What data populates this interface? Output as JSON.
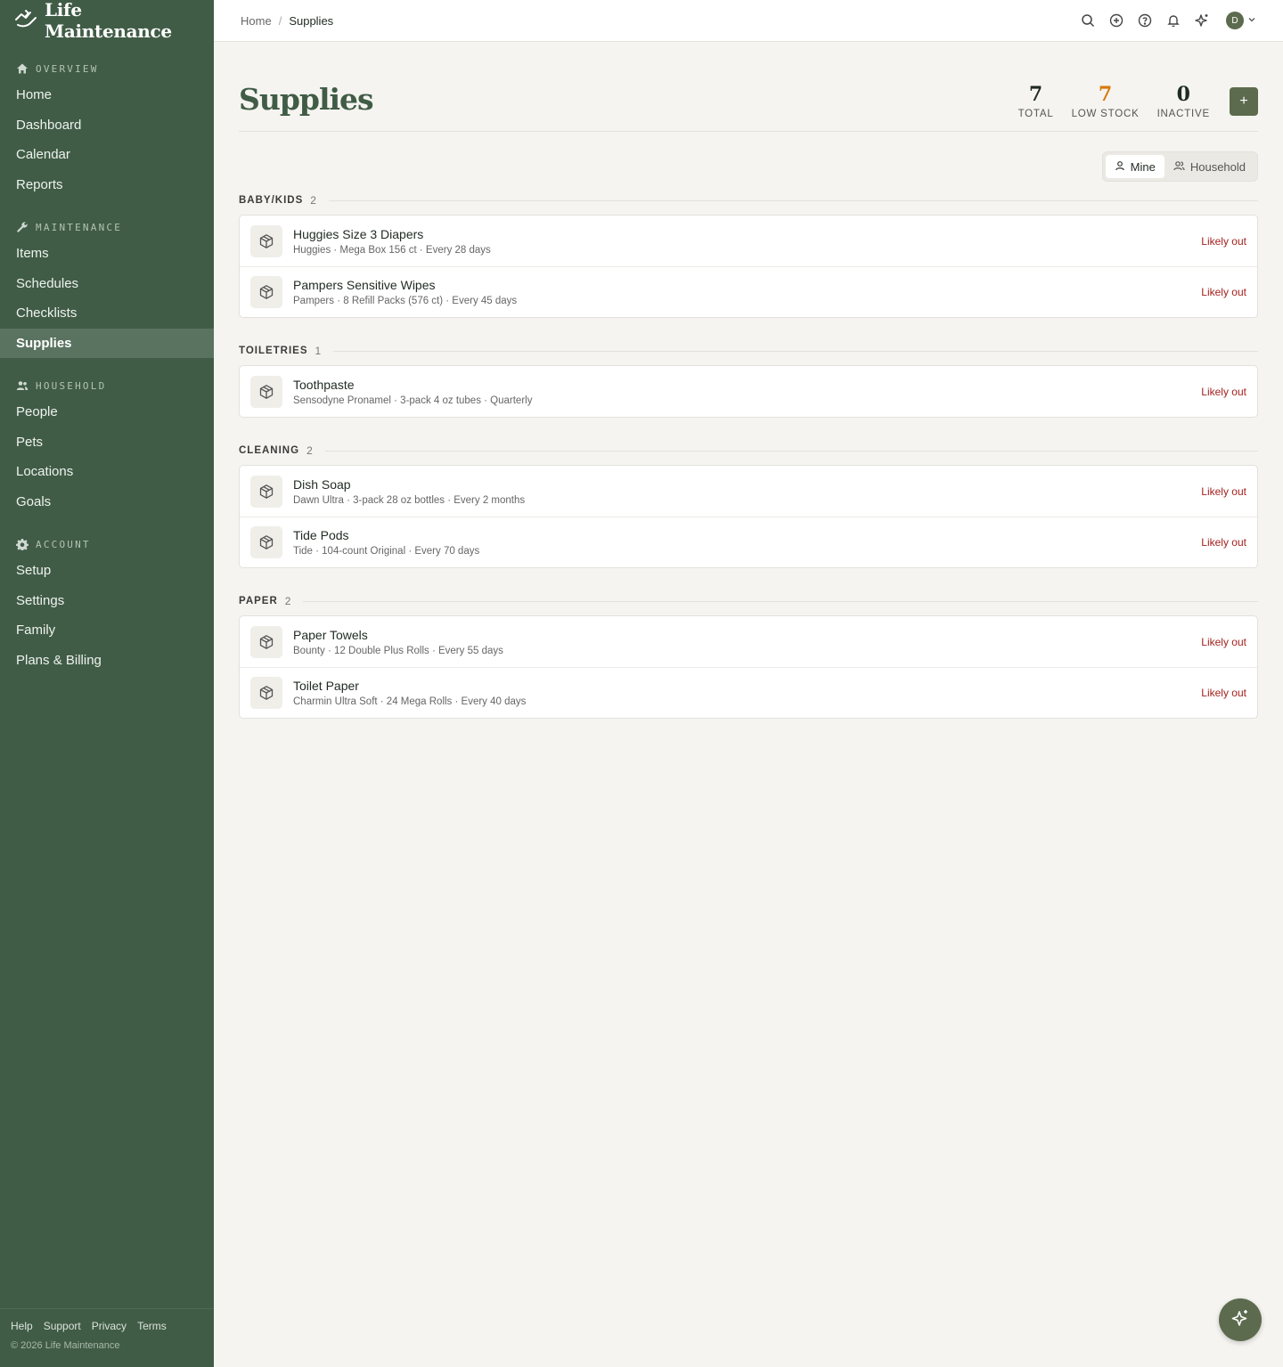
{
  "app": {
    "title": "Life Maintenance",
    "copyright": "© 2026 Life Maintenance"
  },
  "colors": {
    "sidebar": "#405c46",
    "accent": "#5c6b4e",
    "low_stock": "#d97706",
    "status_red": "#a3221f"
  },
  "sidebar": {
    "sections": [
      {
        "title": "OVERVIEW",
        "icon": "home-icon",
        "items": [
          {
            "label": "Home"
          },
          {
            "label": "Dashboard"
          },
          {
            "label": "Calendar"
          },
          {
            "label": "Reports"
          }
        ]
      },
      {
        "title": "MAINTENANCE",
        "icon": "wrench-icon",
        "items": [
          {
            "label": "Items"
          },
          {
            "label": "Schedules"
          },
          {
            "label": "Checklists"
          },
          {
            "label": "Supplies",
            "active": true
          }
        ]
      },
      {
        "title": "HOUSEHOLD",
        "icon": "users-icon",
        "items": [
          {
            "label": "People"
          },
          {
            "label": "Pets"
          },
          {
            "label": "Locations"
          },
          {
            "label": "Goals"
          }
        ]
      },
      {
        "title": "ACCOUNT",
        "icon": "gear-icon",
        "items": [
          {
            "label": "Setup"
          },
          {
            "label": "Settings"
          },
          {
            "label": "Family"
          },
          {
            "label": "Plans & Billing"
          }
        ]
      }
    ],
    "footer_links": [
      "Help",
      "Support",
      "Privacy",
      "Terms"
    ]
  },
  "topbar": {
    "breadcrumb": {
      "home": "Home",
      "separator": "/",
      "current": "Supplies"
    },
    "icons": [
      "search-icon",
      "plus-circle-icon",
      "help-icon",
      "bell-icon",
      "sparkle-icon"
    ],
    "avatar": "D"
  },
  "page": {
    "title": "Supplies",
    "stats": [
      {
        "value": "7",
        "label": "TOTAL",
        "color": "#1f2a22"
      },
      {
        "value": "7",
        "label": "LOW STOCK",
        "color": "#d97706"
      },
      {
        "value": "0",
        "label": "INACTIVE",
        "color": "#1f2a22"
      }
    ],
    "add_label": "+",
    "toggle": {
      "mine": "Mine",
      "household": "Household"
    }
  },
  "groups": [
    {
      "name": "BABY/KIDS",
      "count": "2",
      "items": [
        {
          "name": "Huggies Size 3 Diapers",
          "meta": "Huggies · Mega Box 156 ct · Every 28 days",
          "status": "Likely out"
        },
        {
          "name": "Pampers Sensitive Wipes",
          "meta": "Pampers · 8 Refill Packs (576 ct) · Every 45 days",
          "status": "Likely out"
        }
      ]
    },
    {
      "name": "TOILETRIES",
      "count": "1",
      "items": [
        {
          "name": "Toothpaste",
          "meta": "Sensodyne Pronamel · 3-pack 4 oz tubes · Quarterly",
          "status": "Likely out"
        }
      ]
    },
    {
      "name": "CLEANING",
      "count": "2",
      "items": [
        {
          "name": "Dish Soap",
          "meta": "Dawn Ultra · 3-pack 28 oz bottles · Every 2 months",
          "status": "Likely out"
        },
        {
          "name": "Tide Pods",
          "meta": "Tide · 104-count Original · Every 70 days",
          "status": "Likely out"
        }
      ]
    },
    {
      "name": "PAPER",
      "count": "2",
      "items": [
        {
          "name": "Paper Towels",
          "meta": "Bounty · 12 Double Plus Rolls · Every 55 days",
          "status": "Likely out"
        },
        {
          "name": "Toilet Paper",
          "meta": "Charmin Ultra Soft · 24 Mega Rolls · Every 40 days",
          "status": "Likely out"
        }
      ]
    }
  ]
}
